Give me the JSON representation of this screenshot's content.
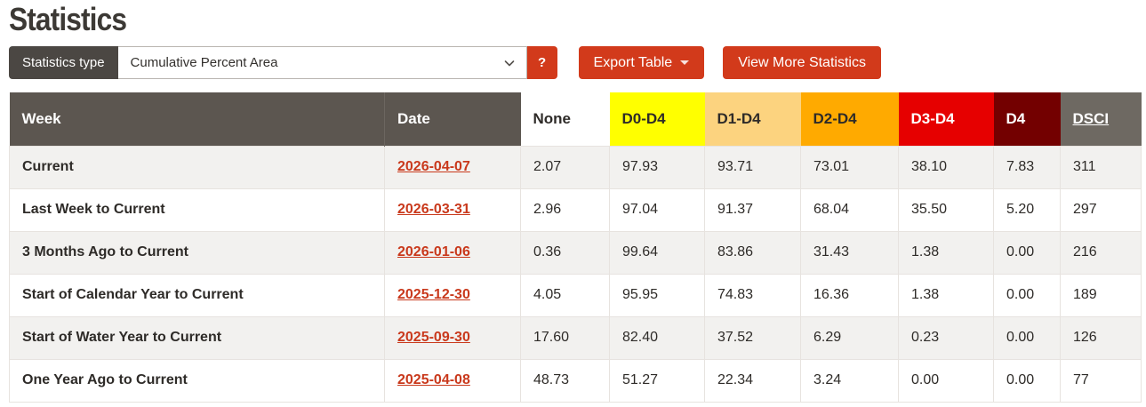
{
  "page": {
    "title": "Statistics"
  },
  "toolbar": {
    "stats_type_label": "Statistics type",
    "stats_type_value": "Cumulative Percent Area",
    "help_label": "?",
    "export_label": "Export Table",
    "view_more_label": "View More Statistics"
  },
  "colors": {
    "accent": "#d23a1b",
    "link": "#c9391c",
    "header_bg": "#5c5650",
    "label_bg": "#4b4743",
    "row_alt": "#f2f1ef",
    "border": "#e7e3df",
    "d0_yellow": "#ffff00",
    "d1_tan": "#fcd37f",
    "d2_orange": "#ffaa00",
    "d3_red": "#e60000",
    "d4_maroon": "#730000",
    "dsci_gray": "#6e6962"
  },
  "table": {
    "columns": [
      {
        "key": "week",
        "label": "Week",
        "bg": "#5c5650",
        "fg": "#ffffff",
        "sep": true
      },
      {
        "key": "date",
        "label": "Date",
        "bg": "#5c5650",
        "fg": "#ffffff"
      },
      {
        "key": "none",
        "label": "None",
        "bg": "#ffffff",
        "fg": "#2e2b28"
      },
      {
        "key": "d0",
        "label": "D0-D4",
        "bg": "#ffff00",
        "fg": "#2e2b28"
      },
      {
        "key": "d1",
        "label": "D1-D4",
        "bg": "#fcd37f",
        "fg": "#2e2b28"
      },
      {
        "key": "d2",
        "label": "D2-D4",
        "bg": "#ffaa00",
        "fg": "#2e2b28"
      },
      {
        "key": "d3",
        "label": "D3-D4",
        "bg": "#e60000",
        "fg": "#ffffff"
      },
      {
        "key": "d4",
        "label": "D4",
        "bg": "#730000",
        "fg": "#ffffff"
      },
      {
        "key": "dsci",
        "label": "DSCI",
        "bg": "#6e6962",
        "fg": "#ffffff",
        "link": true
      }
    ],
    "rows": [
      {
        "week": "Current",
        "date": "2026-04-07",
        "none": "2.07",
        "d0": "97.93",
        "d1": "93.71",
        "d2": "73.01",
        "d3": "38.10",
        "d4": "7.83",
        "dsci": "311"
      },
      {
        "week": "Last Week to Current",
        "date": "2026-03-31",
        "none": "2.96",
        "d0": "97.04",
        "d1": "91.37",
        "d2": "68.04",
        "d3": "35.50",
        "d4": "5.20",
        "dsci": "297"
      },
      {
        "week": "3 Months Ago to Current",
        "date": "2026-01-06",
        "none": "0.36",
        "d0": "99.64",
        "d1": "83.86",
        "d2": "31.43",
        "d3": "1.38",
        "d4": "0.00",
        "dsci": "216"
      },
      {
        "week": "Start of Calendar Year to Current",
        "date": "2025-12-30",
        "none": "4.05",
        "d0": "95.95",
        "d1": "74.83",
        "d2": "16.36",
        "d3": "1.38",
        "d4": "0.00",
        "dsci": "189"
      },
      {
        "week": "Start of Water Year to Current",
        "date": "2025-09-30",
        "none": "17.60",
        "d0": "82.40",
        "d1": "37.52",
        "d2": "6.29",
        "d3": "0.23",
        "d4": "0.00",
        "dsci": "126"
      },
      {
        "week": "One Year Ago to Current",
        "date": "2025-04-08",
        "none": "48.73",
        "d0": "51.27",
        "d1": "22.34",
        "d2": "3.24",
        "d3": "0.00",
        "d4": "0.00",
        "dsci": "77"
      }
    ]
  }
}
